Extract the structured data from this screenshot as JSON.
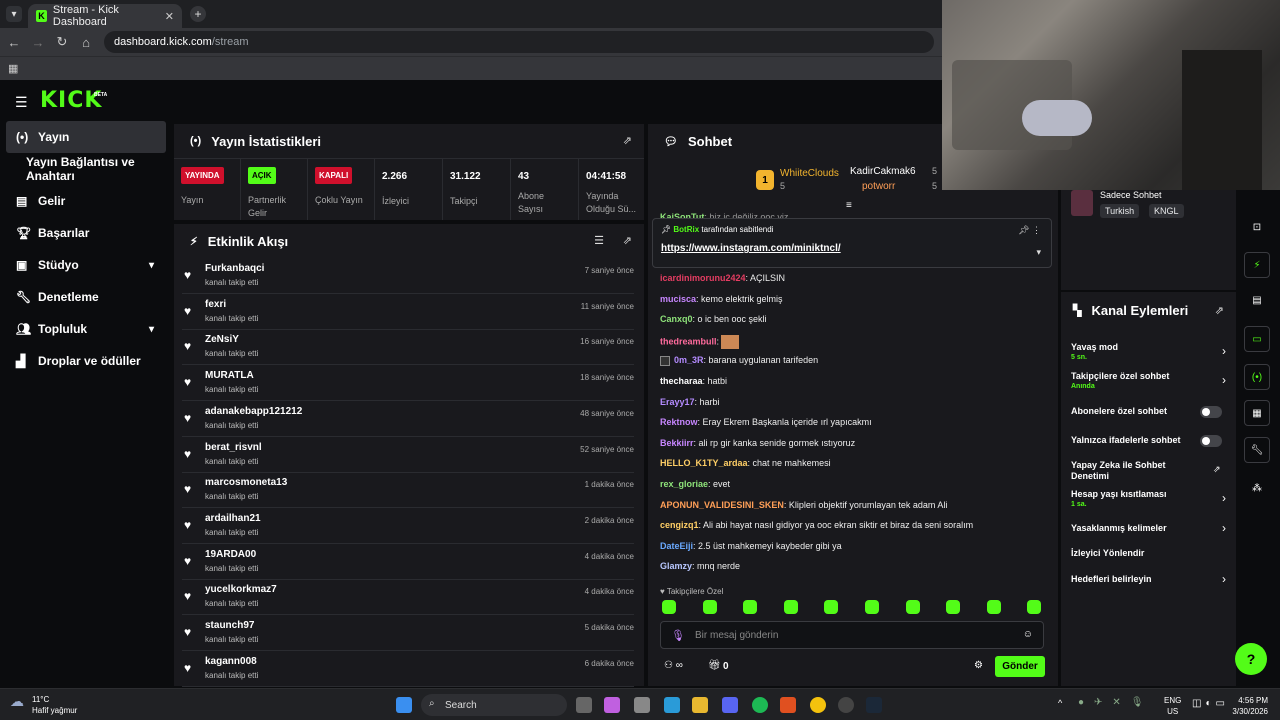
{
  "browser": {
    "tab_title": "Stream - Kick Dashboard",
    "url_host": "dashboard.kick.com",
    "url_path": "/stream"
  },
  "brand": {
    "logo": "KICK",
    "beta": "BETA",
    "accent": "#53fc18"
  },
  "sidebar": {
    "items": [
      {
        "label": "Yayın",
        "icon": "broadcast-icon",
        "active": true
      },
      {
        "label": "Yayın Bağlantısı ve Anahtarı",
        "icon": ""
      },
      {
        "label": "Gelir",
        "icon": "revenue-icon"
      },
      {
        "label": "Başarılar",
        "icon": "trophy-icon"
      },
      {
        "label": "Stüdyo",
        "icon": "studio-icon",
        "chevron": true
      },
      {
        "label": "Denetleme",
        "icon": "wrench-icon"
      },
      {
        "label": "Topluluk",
        "icon": "community-icon",
        "chevron": true
      },
      {
        "label": "Droplar ve ödüller",
        "icon": "drops-icon"
      }
    ]
  },
  "stats": {
    "title": "Yayın İstatistikleri",
    "items": [
      {
        "badge": "YAYINDA",
        "badge_color": "#d0102c",
        "label": "Yayın"
      },
      {
        "badge": "AÇIK",
        "badge_color": "#53fc18",
        "label": "Partnerlik Gelir"
      },
      {
        "badge": "KAPALI",
        "badge_color": "#d0102c",
        "label": "Çoklu Yayın"
      },
      {
        "value": "2.266",
        "label": "İzleyici"
      },
      {
        "value": "31.122",
        "label": "Takipçi"
      },
      {
        "value": "43",
        "label": "Abone Sayısı"
      },
      {
        "value": "04:41:58",
        "label": "Yayında Olduğu Sü..."
      }
    ]
  },
  "activity": {
    "title": "Etkinlik Akışı",
    "rows": [
      {
        "name": "Furkanbaqci",
        "sub": "kanalı takip etti",
        "time": "7 saniye önce"
      },
      {
        "name": "fexri",
        "sub": "kanalı takip etti",
        "time": "11 saniye önce"
      },
      {
        "name": "ZeNsiY",
        "sub": "kanalı takip etti",
        "time": "16 saniye önce"
      },
      {
        "name": "MURATLA",
        "sub": "kanalı takip etti",
        "time": "18 saniye önce"
      },
      {
        "name": "adanakebapp121212",
        "sub": "kanalı takip etti",
        "time": "48 saniye önce"
      },
      {
        "name": "berat_risvnl",
        "sub": "kanalı takip etti",
        "time": "52 saniye önce"
      },
      {
        "name": "marcosmoneta13",
        "sub": "kanalı takip etti",
        "time": "1 dakika önce"
      },
      {
        "name": "ardailhan21",
        "sub": "kanalı takip etti",
        "time": "2 dakika önce"
      },
      {
        "name": "19ARDA00",
        "sub": "kanalı takip etti",
        "time": "4 dakika önce"
      },
      {
        "name": "yucelkorkmaz7",
        "sub": "kanalı takip etti",
        "time": "4 dakika önce"
      },
      {
        "name": "staunch97",
        "sub": "kanalı takip etti",
        "time": "5 dakika önce"
      },
      {
        "name": "kagann008",
        "sub": "kanalı takip etti",
        "time": "6 dakika önce"
      }
    ]
  },
  "chat": {
    "title": "Sohbet",
    "leaderboard": [
      {
        "rank": "1",
        "name": "WhiiteClouds",
        "count": "5"
      },
      {
        "name": "KadirCakmak6",
        "count": "5"
      },
      {
        "name": "potworr",
        "count": "5"
      }
    ],
    "partial_msg": {
      "user": "KaiSonTut",
      "text": ": biz iç değiliz ooc yiz"
    },
    "pinned": {
      "by_user": "BotRix",
      "by_text": "tarafından sabitlendi",
      "link": "https://www.instagram.com/miniktncl/"
    },
    "messages": [
      {
        "user": "icardinimorunu2424",
        "color": "#e53d62",
        "text": ": AÇILSIN"
      },
      {
        "user": "mucisca",
        "color": "#c786ff",
        "text": ": kemo elektrik gelmiş"
      },
      {
        "user": "Canxq0",
        "color": "#8ee37a",
        "text": ": o ic ben ooc şekli"
      },
      {
        "user": "thedreambull",
        "color": "#ff6b9d",
        "text": ":"
      },
      {
        "user": "0m_3R",
        "color": "#b48bff",
        "text": ": barana uygulanan tarifeden"
      },
      {
        "user": "thecharaa",
        "color": "#ffffff",
        "text": ": hatbi"
      },
      {
        "user": "Erayy17",
        "color": "#b48bff",
        "text": ": harbi"
      },
      {
        "user": "Rektnow",
        "color": "#c786ff",
        "text": ": Eray Ekrem Başkanla içeride ırl yapıcakmı"
      },
      {
        "user": "Bekkiirr",
        "color": "#c786ff",
        "text": ": ali rp gir kanka senide gormek ıstıyoruz"
      },
      {
        "user": "HELLO_K1TY_ardaa",
        "color": "#ffcf66",
        "text": ": chat ne mahkemesi"
      },
      {
        "user": "rex_gloriae",
        "color": "#8ee37a",
        "text": ": evet"
      },
      {
        "user": "APONUN_VALIDESINI_SKEN",
        "color": "#ff9f57",
        "text": ": Klipleri objektif yorumlayan tek adam Ali"
      },
      {
        "user": "cengizq1",
        "color": "#ffcf66",
        "text": ": Ali abi hayat nasıl gidiyor ya ooc ekran siktir et biraz da seni soralım"
      },
      {
        "user": "DateEiji",
        "color": "#6aa9ff",
        "text": ": 2.5 üst mahkemeyi kaybeder gibi ya"
      },
      {
        "user": "Glamzy",
        "color": "#b9c8ff",
        "text": ": mnq nerde"
      }
    ],
    "followers_only": "Takipçilere Özel",
    "placeholder": "Bir mesaj gönderin",
    "send": "Gönder",
    "count": "0"
  },
  "chat_info": {
    "name": "Sadece Sohbet",
    "tags": [
      "Turkish",
      "KNGL"
    ]
  },
  "channel_actions": {
    "title": "Kanal Eylemleri",
    "rows": [
      {
        "label": "Yavaş mod",
        "sub": "5 sn.",
        "type": "chevron"
      },
      {
        "label": "Takipçilere özel sohbet",
        "sub": "Anında",
        "type": "chevron"
      },
      {
        "label": "Abonelere özel sohbet",
        "type": "toggle",
        "state": "off"
      },
      {
        "label": "Yalnızca ifadelerle sohbet",
        "type": "toggle",
        "state": "off"
      },
      {
        "label": "Yapay Zeka ile Sohbet Denetimi",
        "type": "external"
      },
      {
        "label": "Hesap yaşı kısıtlaması",
        "sub": "1 sa.",
        "type": "chevron"
      },
      {
        "label": "Yasaklanmış kelimeler",
        "type": "chevron"
      },
      {
        "label": "İzleyici Yönlendir",
        "type": "none"
      },
      {
        "label": "Hedefleri belirleyin",
        "type": "chevron"
      }
    ]
  },
  "taskbar": {
    "temp": "11°C",
    "weather": "Hafif yağmur",
    "search": "Search",
    "lang1": "ENG",
    "lang2": "US",
    "time": "4:56 PM",
    "date": "3/30/2026"
  }
}
